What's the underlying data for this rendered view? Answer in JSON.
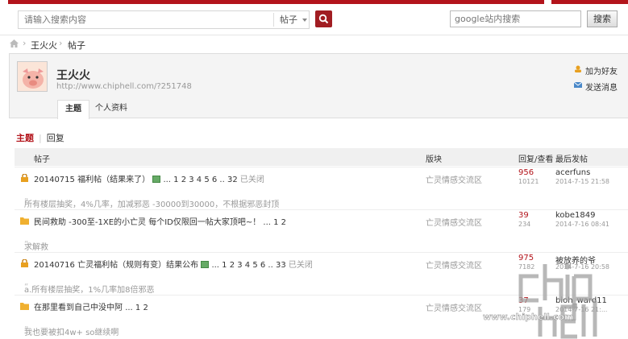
{
  "search": {
    "placeholder": "请输入搜索内容",
    "scope": "帖子",
    "google_placeholder": "google站内搜索",
    "google_button": "搜索"
  },
  "breadcrumb": [
    "王火火",
    "帖子"
  ],
  "profile": {
    "name": "王火火",
    "url": "http://www.chiphell.com/?251748",
    "add_friend": "加为好友",
    "send_message": "发送消息",
    "tabs": [
      "主题",
      "个人资料"
    ]
  },
  "subtabs": {
    "active": "主题",
    "other": "回复"
  },
  "table": {
    "headers": {
      "post": "帖子",
      "forum": "版块",
      "stats": "回复/查看",
      "last": "最后发帖"
    },
    "rows": [
      {
        "title": "20140715 福利帖（结果来了）",
        "pages": "...  1  2  3  4  5  6  .. 32",
        "status": "已关闭",
        "forum": "亡灵情感交流区",
        "replies": "956",
        "views": "10121",
        "last_user": "acerfuns",
        "last_time": "2014-7-15 21:58",
        "quote": "所有楼层抽奖，4%几率，加减邪恶 -30000到30000，不根据邪恶封顶"
      },
      {
        "title": "民间救助 -300至-1XE的小亡灵 每个ID仅限回一帖大家顶吧~！",
        "pages": "...  1  2",
        "status": "",
        "forum": "亡灵情感交流区",
        "replies": "39",
        "views": "234",
        "last_user": "kobe1849",
        "last_time": "2014-7-16 08:41",
        "quote": "求解救"
      },
      {
        "title": "20140716 亡灵福利帖（规则有变）结果公布",
        "pages": "...  1  2  3  4  5  6  .. 33",
        "status": "已关闭",
        "forum": "亡灵情感交流区",
        "replies": "975",
        "views": "7182",
        "last_user": "被放养的爷",
        "last_time": "2014-7-16 20:58",
        "quote": "a.所有楼层抽奖，1%几率加8倍邪恶"
      },
      {
        "title": "在那里看到自己中没中阿",
        "pages": "...  1  2",
        "status": "",
        "forum": "亡灵情感交流区",
        "replies": "37",
        "views": "179",
        "last_user": "bioh_ward11",
        "last_time": "2014-7-16 21:...",
        "quote": "我也要被扣4w+ so继续啊"
      }
    ]
  },
  "watermark": "www.chiphell.com",
  "colors": {
    "accent": "#b3141b",
    "muted": "#999999"
  }
}
